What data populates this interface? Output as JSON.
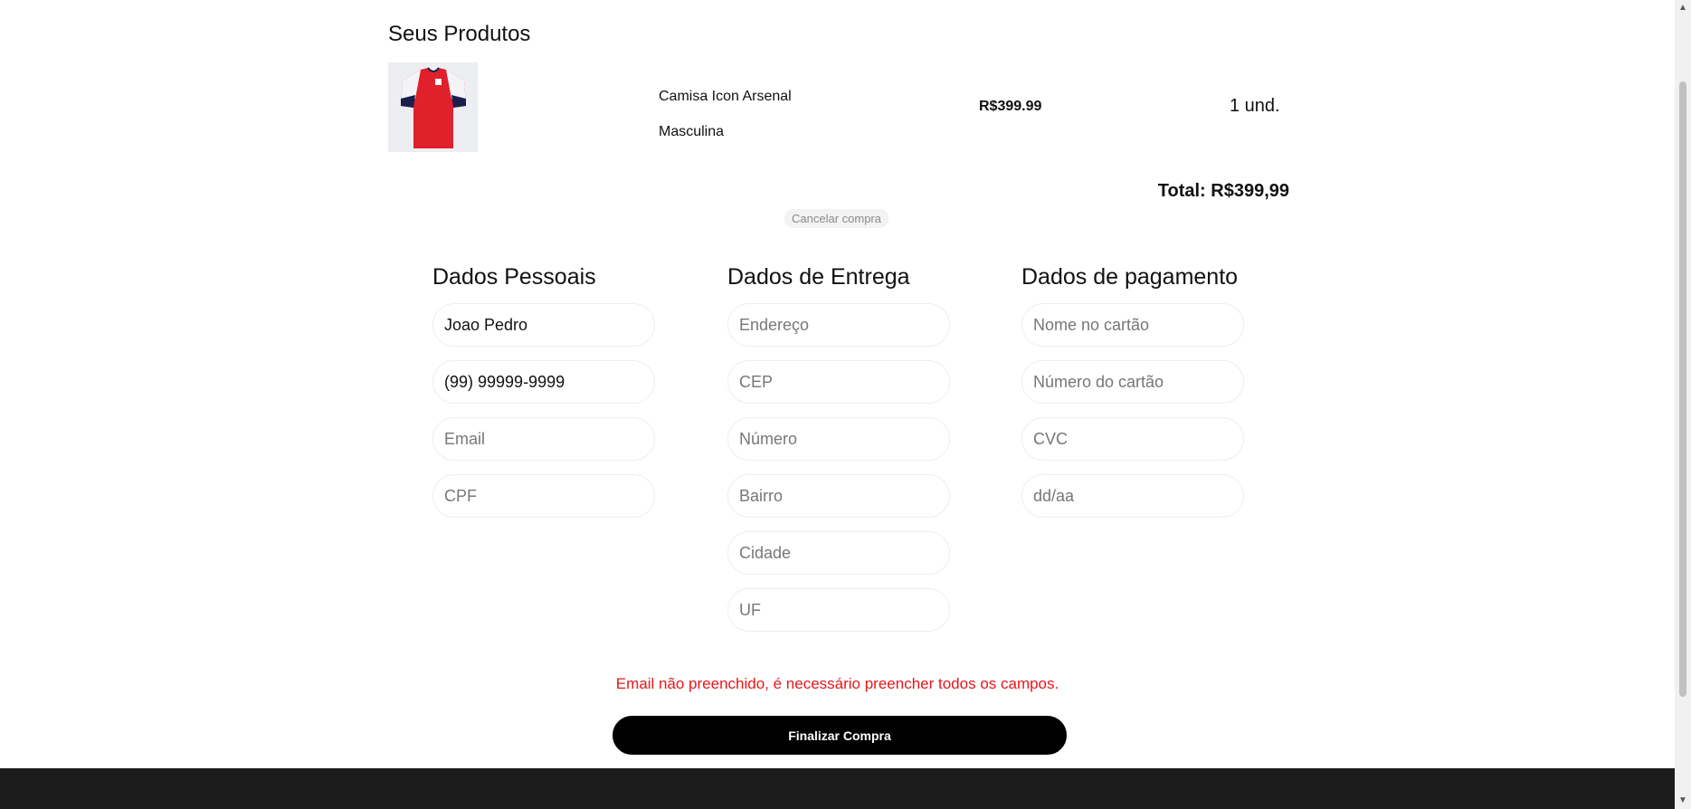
{
  "cart": {
    "title": "Seus Produtos",
    "products": [
      {
        "name": "Camisa Icon Arsenal Masculina",
        "price": "R$399.99",
        "quantity": "1 und.",
        "image_icon": "red-jersey-image"
      }
    ],
    "total": "Total: R$399,99",
    "cancel_label": "Cancelar compra"
  },
  "personal": {
    "title": "Dados Pessoais",
    "name": {
      "value": "Joao Pedro",
      "placeholder": ""
    },
    "phone": {
      "value": "(99) 99999-9999",
      "placeholder": ""
    },
    "email": {
      "value": "",
      "placeholder": "Email"
    },
    "cpf": {
      "value": "",
      "placeholder": "CPF"
    }
  },
  "delivery": {
    "title": "Dados de Entrega",
    "address": {
      "placeholder": "Endereço"
    },
    "cep": {
      "placeholder": "CEP"
    },
    "number": {
      "placeholder": "Número"
    },
    "district": {
      "placeholder": "Bairro"
    },
    "city": {
      "placeholder": "Cidade"
    },
    "state": {
      "placeholder": "UF"
    }
  },
  "payment": {
    "title": "Dados de pagamento",
    "card_name": {
      "placeholder": "Nome no cartão"
    },
    "card_number": {
      "placeholder": "Número do cartão"
    },
    "cvc": {
      "placeholder": "CVC"
    },
    "expiry": {
      "placeholder": "dd/aa"
    }
  },
  "error_message": "Email não preenchido, é necessário preencher todos os campos.",
  "finish_label": "Finalizar Compra",
  "colors": {
    "error": "#e8151a",
    "button_bg": "#000000",
    "footer_bg": "#1c1c1c",
    "jersey_red": "#e0202a",
    "jersey_navy": "#1b1f4d"
  }
}
